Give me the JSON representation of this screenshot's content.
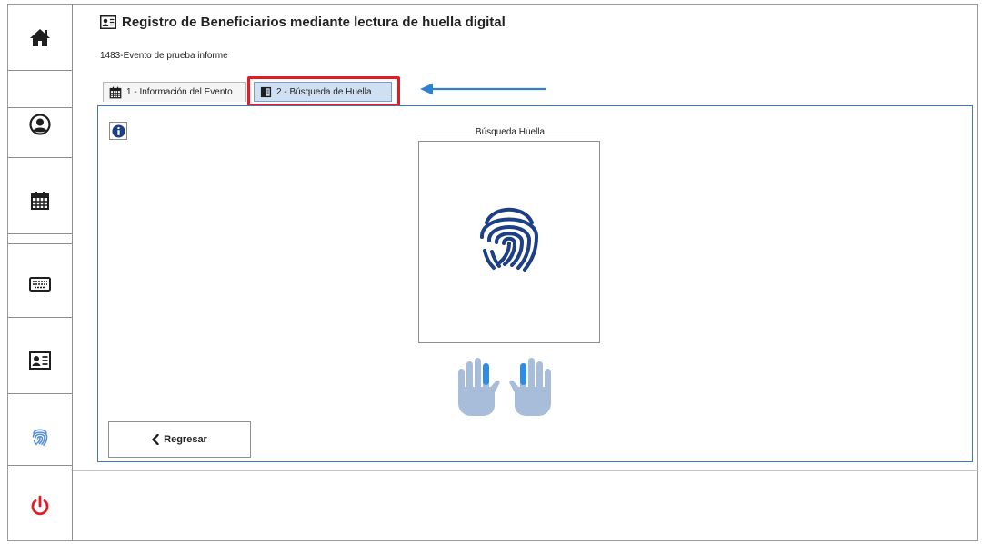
{
  "header": {
    "title": "Registro de Beneficiarios mediante lectura de huella digital",
    "event": "1483-Evento de prueba informe"
  },
  "sidebar": {
    "items": [
      {
        "icon": "home-icon"
      },
      {
        "icon": "user-icon"
      },
      {
        "icon": "calendar-icon"
      },
      {
        "icon": "keyboard-icon"
      },
      {
        "icon": "id-card-icon"
      },
      {
        "icon": "fingerprint-icon"
      },
      {
        "icon": "power-icon"
      }
    ]
  },
  "tabs": [
    {
      "label": "1 - Información del Evento",
      "icon": "calendar-icon"
    },
    {
      "label": "2 - Búsqueda de Huella",
      "icon": "book-icon",
      "active": true
    }
  ],
  "main": {
    "fingerprint_section_label": "Búsqueda Huella",
    "back_button_label": "Regresar"
  },
  "colors": {
    "accent_blue": "#3f78c1",
    "highlight_red": "#e21c24",
    "fingerprint_navy": "#1d3f86",
    "power_red": "#e21c24"
  }
}
